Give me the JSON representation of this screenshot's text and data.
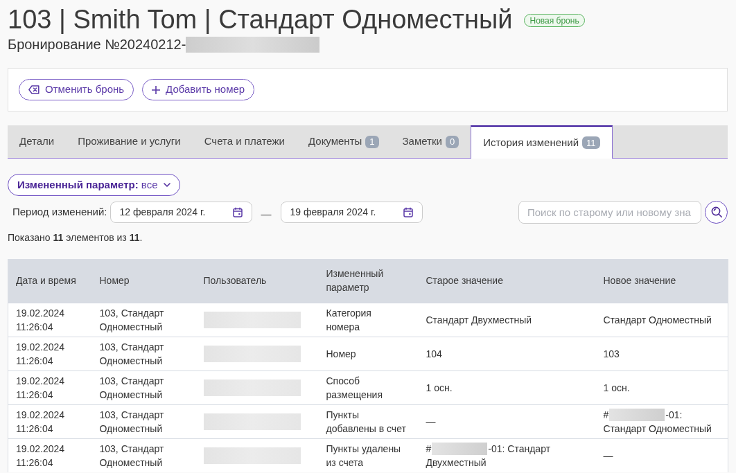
{
  "header": {
    "title": "103 | Smith Tom | Стандарт Одноместный",
    "status_badge": "Новая бронь",
    "booking_number": "Бронирование №20240212-"
  },
  "actions": [
    {
      "kind": "cancel",
      "label": "Отменить бронь"
    },
    {
      "kind": "add",
      "label": "Добавить номер"
    }
  ],
  "tabs": [
    {
      "label": "Детали",
      "selected": false
    },
    {
      "label": "Проживание и услуги",
      "selected": false
    },
    {
      "label": "Счета и платежи",
      "selected": false
    },
    {
      "label": "Документы",
      "count": "1",
      "selected": false
    },
    {
      "label": "Заметки",
      "count": "0",
      "selected": false
    },
    {
      "label": "История изменений",
      "count": "11",
      "selected": true
    }
  ],
  "filter": {
    "label": "**Измененный параметр:** все"
  },
  "period": {
    "label": "Период изменений:",
    "from": "12 февраля 2024 г.",
    "separator": "—",
    "to": "19 февраля 2024 г."
  },
  "search": {
    "placeholder": "Поиск по старому или новому зна"
  },
  "summary": "Показано **11** элементов из **11**.",
  "table": {
    "columns": [
      "Дата и время",
      "Номер",
      "Пользователь",
      "Измененный параметр",
      "Старое значение",
      "Новое значение"
    ],
    "rows": [
      {
        "cells": [
          {
            "kind": "text",
            "text": "19.02.2024 11:26:04"
          },
          {
            "kind": "text",
            "text": "103, Стандарт Одноместный"
          },
          {
            "kind": "redacted"
          },
          {
            "kind": "text",
            "text": "Категория номера"
          },
          {
            "kind": "text",
            "text": "Стандарт Двухместный"
          },
          {
            "kind": "text",
            "text": "Стандарт Одноместный"
          }
        ]
      },
      {
        "cells": [
          {
            "kind": "text",
            "text": "19.02.2024 11:26:04"
          },
          {
            "kind": "text",
            "text": "103, Стандарт Одноместный"
          },
          {
            "kind": "redacted"
          },
          {
            "kind": "text",
            "text": "Номер"
          },
          {
            "kind": "text",
            "text": "104"
          },
          {
            "kind": "text",
            "text": "103"
          }
        ]
      },
      {
        "cells": [
          {
            "kind": "text",
            "text": "19.02.2024 11:26:04"
          },
          {
            "kind": "text",
            "text": "103, Стандарт Одноместный"
          },
          {
            "kind": "redacted"
          },
          {
            "kind": "text",
            "text": "Способ размещения"
          },
          {
            "kind": "text",
            "text": "1 осн."
          },
          {
            "kind": "text",
            "text": "1 осн."
          }
        ]
      },
      {
        "cells": [
          {
            "kind": "text",
            "text": "19.02.2024 11:26:04"
          },
          {
            "kind": "text",
            "text": "103, Стандарт Одноместный"
          },
          {
            "kind": "redacted"
          },
          {
            "kind": "text",
            "text": "Пункты добавлены в счет"
          },
          {
            "kind": "text",
            "text": "—"
          },
          {
            "kind": "ref",
            "before": "#",
            "after": "-01: Стандарт Одноместный"
          }
        ]
      },
      {
        "cells": [
          {
            "kind": "text",
            "text": "19.02.2024 11:26:04"
          },
          {
            "kind": "text",
            "text": "103, Стандарт Одноместный"
          },
          {
            "kind": "redacted"
          },
          {
            "kind": "text",
            "text": "Пункты удалены из счета"
          },
          {
            "kind": "ref",
            "before": "#",
            "after": "-01: Стандарт Двухместный"
          },
          {
            "kind": "text",
            "text": "—"
          }
        ]
      }
    ]
  }
}
